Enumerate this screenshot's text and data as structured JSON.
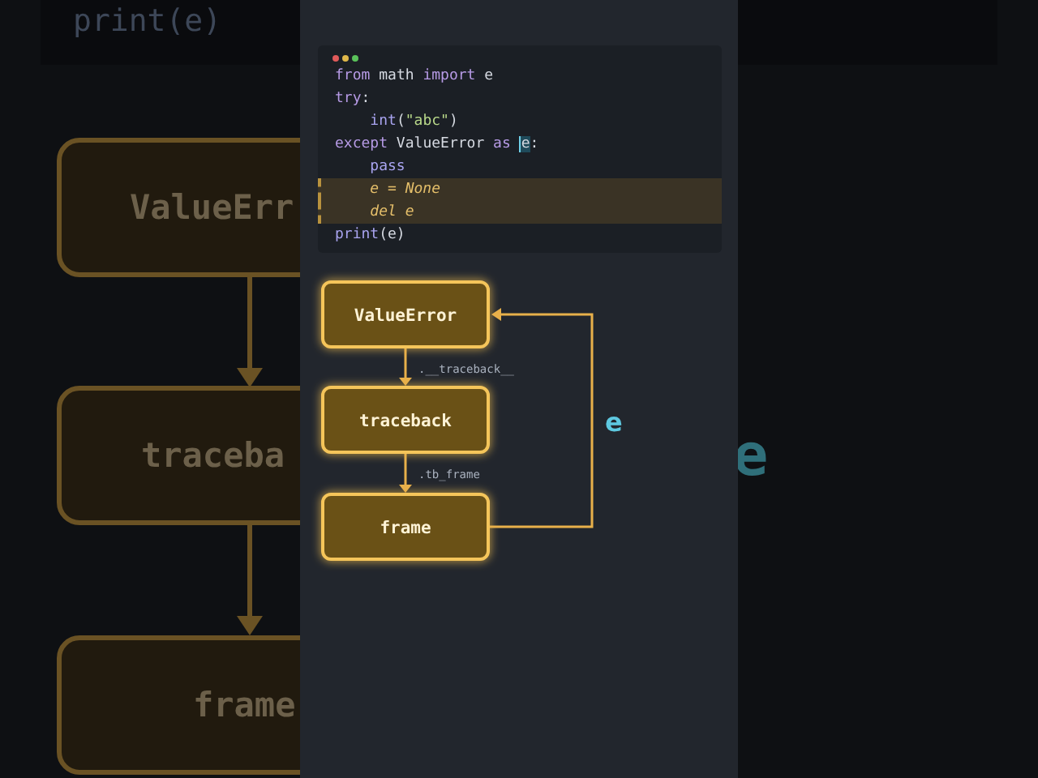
{
  "backdrop": {
    "code": "print(e)",
    "nodes": [
      "ValueErr",
      "traceba",
      "frame"
    ],
    "label": "e"
  },
  "code": {
    "lines": [
      {
        "highlighted": false,
        "tokens": [
          {
            "kind": "keyword",
            "text": "from"
          },
          {
            "kind": "plain",
            "text": " math "
          },
          {
            "kind": "keyword",
            "text": "import"
          },
          {
            "kind": "plain",
            "text": " e"
          }
        ]
      },
      {
        "highlighted": false,
        "tokens": [
          {
            "kind": "keyword",
            "text": "try"
          },
          {
            "kind": "plain",
            "text": ":"
          }
        ]
      },
      {
        "highlighted": false,
        "tokens": [
          {
            "kind": "builtin",
            "text": "    int"
          },
          {
            "kind": "plain",
            "text": "("
          },
          {
            "kind": "string",
            "text": "\"abc\""
          },
          {
            "kind": "plain",
            "text": ")"
          }
        ]
      },
      {
        "highlighted": false,
        "tokens": [
          {
            "kind": "keyword",
            "text": "except"
          },
          {
            "kind": "plain",
            "text": " ValueError "
          },
          {
            "kind": "keyword",
            "text": "as "
          },
          {
            "kind": "cursor",
            "text": "e"
          },
          {
            "kind": "plain",
            "text": ":"
          }
        ]
      },
      {
        "highlighted": false,
        "tokens": [
          {
            "kind": "builtin",
            "text": "    pass"
          }
        ]
      },
      {
        "highlighted": true,
        "tokens": [
          {
            "kind": "plain",
            "text": "    e = None"
          }
        ]
      },
      {
        "highlighted": true,
        "tokens": [
          {
            "kind": "plain",
            "text": "    del e"
          }
        ]
      },
      {
        "highlighted": false,
        "tokens": [
          {
            "kind": "builtin",
            "text": "print"
          },
          {
            "kind": "plain",
            "text": "(e)"
          }
        ]
      }
    ]
  },
  "diagram": {
    "nodes": [
      {
        "label": "ValueError"
      },
      {
        "label": "traceback"
      },
      {
        "label": "frame"
      }
    ],
    "edges": [
      {
        "label": ".__traceback__"
      },
      {
        "label": ".tb_frame"
      }
    ],
    "loop_label": "e"
  }
}
